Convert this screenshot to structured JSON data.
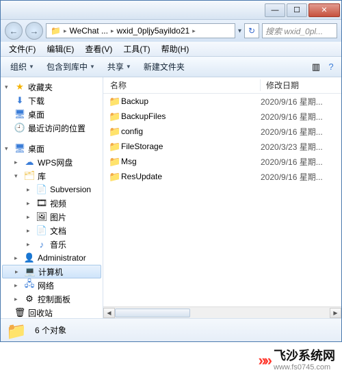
{
  "titlebar": {
    "min": "—",
    "max": "☐",
    "close": "✕"
  },
  "address": {
    "back": "←",
    "fwd": "→",
    "seg1": "WeChat ...",
    "seg2": "wxid_0pljy5ayildo21",
    "refresh": "↻",
    "search_placeholder": "搜索 wxid_0pl..."
  },
  "menu": {
    "file": "文件(F)",
    "edit": "编辑(E)",
    "view": "查看(V)",
    "tools": "工具(T)",
    "help": "帮助(H)"
  },
  "toolbar": {
    "organize": "组织",
    "include": "包含到库中",
    "share": "共享",
    "newfolder": "新建文件夹",
    "views_icon": "▥",
    "help_icon": "?"
  },
  "sidebar": {
    "favorites": "收藏夹",
    "downloads": "下载",
    "desktop": "桌面",
    "recent": "最近访问的位置",
    "desktop2": "桌面",
    "wps": "WPS网盘",
    "library": "库",
    "subversion": "Subversion",
    "video": "视频",
    "pictures": "图片",
    "documents": "文档",
    "music": "音乐",
    "admin": "Administrator",
    "computer": "计算机",
    "network": "网络",
    "controlpanel": "控制面板",
    "recycle": "回收站"
  },
  "columns": {
    "name": "名称",
    "date": "修改日期"
  },
  "files": [
    {
      "name": "Backup",
      "date": "2020/9/16 星期..."
    },
    {
      "name": "BackupFiles",
      "date": "2020/9/16 星期..."
    },
    {
      "name": "config",
      "date": "2020/9/16 星期..."
    },
    {
      "name": "FileStorage",
      "date": "2020/3/23 星期..."
    },
    {
      "name": "Msg",
      "date": "2020/9/16 星期..."
    },
    {
      "name": "ResUpdate",
      "date": "2020/9/16 星期..."
    }
  ],
  "status": {
    "count": "6 个对象"
  },
  "watermark": {
    "title": "飞沙系统网",
    "url": "www.fs0745.com"
  }
}
